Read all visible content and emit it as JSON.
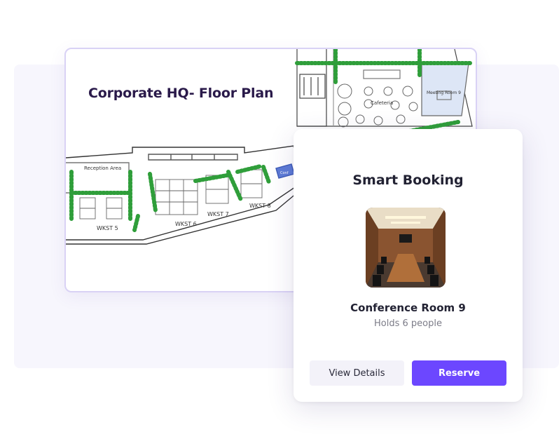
{
  "floor_plan": {
    "title": "Corporate HQ- Floor Plan",
    "labels": {
      "reception": "Reception Area",
      "wkst5": "WKST 5",
      "wkst6": "WKST 6",
      "wkst7": "WKST 7",
      "wkst8": "WKST 8",
      "cafeteria": "Cafeteria",
      "meeting9": "Meeting Room 9",
      "conf": "Conf"
    }
  },
  "booking": {
    "title": "Smart Booking",
    "room_name": "Conference Room 9",
    "room_capacity": "Holds 6 people",
    "view_details_label": "View Details",
    "reserve_label": "Reserve"
  },
  "colors": {
    "accent": "#6c47ff",
    "plant_green": "#2f9e3a",
    "title_ink": "#2a1a4a"
  }
}
